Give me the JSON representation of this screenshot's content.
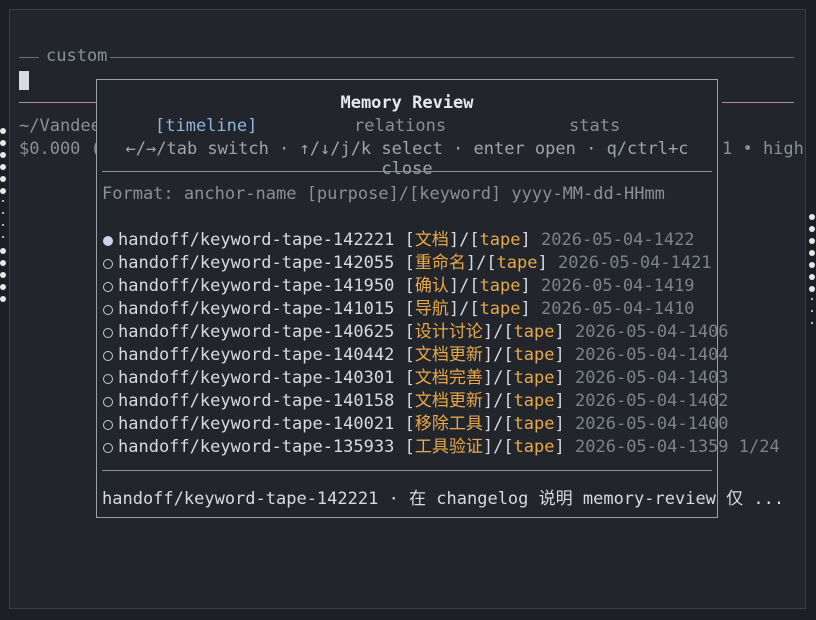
{
  "background": {
    "section_label": "custom",
    "path_fragment": "~/Vandee",
    "cost_fragment": "$0.000 (",
    "right_fragment": "1 • high"
  },
  "modal": {
    "title": "Memory Review",
    "tabs": [
      {
        "label": "[timeline]",
        "active": true
      },
      {
        "label": "relations",
        "active": false
      },
      {
        "label": "stats",
        "active": false
      }
    ],
    "hint": "←/→/tab switch · ↑/↓/j/k select · enter open · q/ctrl+c close",
    "format_line": "Format: anchor-name [purpose]/[keyword] yyyy-MM-dd-HHmm",
    "entries": [
      {
        "name": "handoff/keyword-tape-142221",
        "purpose": "文档",
        "keyword": "tape",
        "date": "2026-05-04-1422",
        "selected": true
      },
      {
        "name": "handoff/keyword-tape-142055",
        "purpose": "重命名",
        "keyword": "tape",
        "date": "2026-05-04-1421",
        "selected": false
      },
      {
        "name": "handoff/keyword-tape-141950",
        "purpose": "确认",
        "keyword": "tape",
        "date": "2026-05-04-1419",
        "selected": false
      },
      {
        "name": "handoff/keyword-tape-141015",
        "purpose": "导航",
        "keyword": "tape",
        "date": "2026-05-04-1410",
        "selected": false
      },
      {
        "name": "handoff/keyword-tape-140625",
        "purpose": "设计讨论",
        "keyword": "tape",
        "date": "2026-05-04-1406",
        "selected": false
      },
      {
        "name": "handoff/keyword-tape-140442",
        "purpose": "文档更新",
        "keyword": "tape",
        "date": "2026-05-04-1404",
        "selected": false
      },
      {
        "name": "handoff/keyword-tape-140301",
        "purpose": "文档完善",
        "keyword": "tape",
        "date": "2026-05-04-1403",
        "selected": false
      },
      {
        "name": "handoff/keyword-tape-140158",
        "purpose": "文档更新",
        "keyword": "tape",
        "date": "2026-05-04-1402",
        "selected": false
      },
      {
        "name": "handoff/keyword-tape-140021",
        "purpose": "移除工具",
        "keyword": "tape",
        "date": "2026-05-04-1400",
        "selected": false
      },
      {
        "name": "handoff/keyword-tape-135933",
        "purpose": "工具验证",
        "keyword": "tape",
        "date": "2026-05-04-1359",
        "selected": false
      }
    ],
    "page_indicator": "1/24",
    "footer": "handoff/keyword-tape-142221 · 在 changelog 说明 memory-review 仅 ..."
  },
  "colors": {
    "keyword": "#e8a94a",
    "active_tab": "#8fb4e0",
    "date": "#7d828b"
  }
}
